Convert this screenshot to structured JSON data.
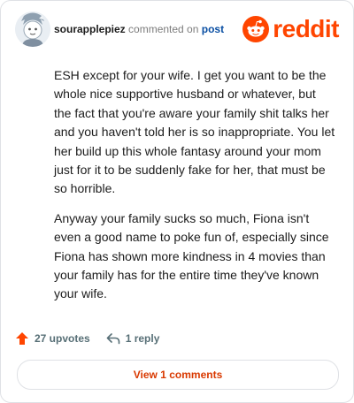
{
  "header": {
    "username": "sourapplepiez",
    "action_text": "commented on",
    "link_text": "post",
    "brand": "reddit"
  },
  "comment": {
    "paragraphs": [
      "ESH except for your wife. I get you want to be the whole nice supportive husband or whatever, but the fact that you're aware your family shit talks her and you haven't told her is so inappropriate. You let her build up this whole fantasy around your mom just for it to be suddenly fake for her, that must be so horrible.",
      "Anyway your family sucks so much, Fiona isn't even a good name to poke fun of, especially since Fiona has shown more kindness in 4 movies than your family has for the entire time they've known your wife."
    ]
  },
  "footer": {
    "upvotes": "27 upvotes",
    "replies": "1 reply",
    "view_comments": "View 1 comments"
  },
  "colors": {
    "brand": "#ff4500",
    "view_button_text": "#d93900",
    "link": "#0a4fa3"
  },
  "icons": [
    "avatar",
    "reddit-snoo-icon",
    "upvote-arrow-icon",
    "reply-arrow-icon"
  ]
}
